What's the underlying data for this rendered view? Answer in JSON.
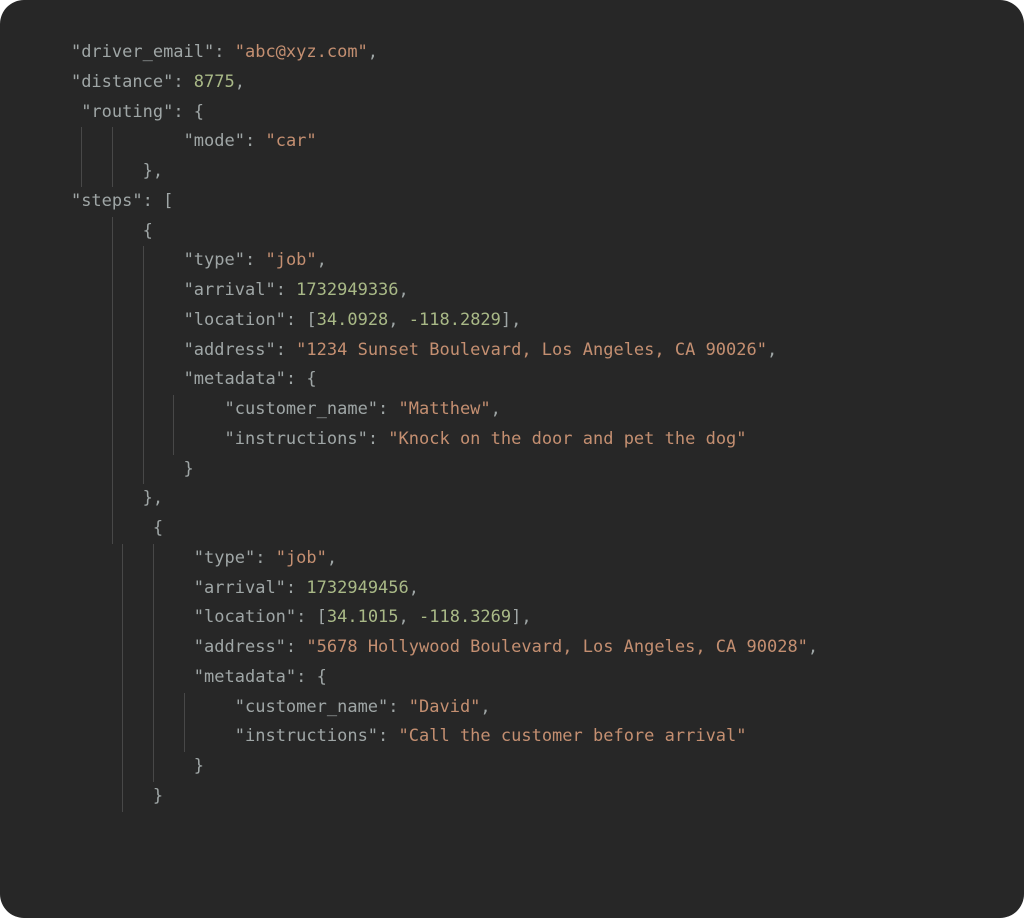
{
  "code": {
    "lines": [
      {
        "segments": [
          {
            "t": "    ",
            "c": "sp"
          },
          {
            "t": "\"driver_email\"",
            "c": "key"
          },
          {
            "t": ": ",
            "c": "punct"
          },
          {
            "t": "\"abc@xyz.com\"",
            "c": "string"
          },
          {
            "t": ",",
            "c": "punct"
          }
        ]
      },
      {
        "segments": [
          {
            "t": "    ",
            "c": "sp"
          },
          {
            "t": "\"distance\"",
            "c": "key"
          },
          {
            "t": ": ",
            "c": "punct"
          },
          {
            "t": "8775",
            "c": "number"
          },
          {
            "t": ",",
            "c": "punct"
          }
        ]
      },
      {
        "segments": [
          {
            "t": "     ",
            "c": "sp"
          },
          {
            "t": "\"routing\"",
            "c": "key"
          },
          {
            "t": ": {",
            "c": "punct"
          }
        ]
      },
      {
        "guides": 2,
        "guidePrefix": "     ",
        "segments": [
          {
            "t": "      ",
            "c": "sp"
          },
          {
            "t": "\"mode\"",
            "c": "key"
          },
          {
            "t": ": ",
            "c": "punct"
          },
          {
            "t": "\"car\"",
            "c": "string"
          }
        ]
      },
      {
        "guides": 2,
        "guidePrefix": "     ",
        "segments": [
          {
            "t": "  },",
            "c": "punct"
          }
        ]
      },
      {
        "segments": [
          {
            "t": "    ",
            "c": "sp"
          },
          {
            "t": "\"steps\"",
            "c": "key"
          },
          {
            "t": ": [",
            "c": "punct"
          }
        ]
      },
      {
        "guides": 1,
        "guidePrefix": "        ",
        "segments": [
          {
            "t": "  {",
            "c": "punct"
          }
        ]
      },
      {
        "guides": 2,
        "guidePrefix": "        ",
        "segments": [
          {
            "t": "   ",
            "c": "sp"
          },
          {
            "t": "\"type\"",
            "c": "key"
          },
          {
            "t": ": ",
            "c": "punct"
          },
          {
            "t": "\"job\"",
            "c": "string"
          },
          {
            "t": ",",
            "c": "punct"
          }
        ]
      },
      {
        "guides": 2,
        "guidePrefix": "        ",
        "segments": [
          {
            "t": "   ",
            "c": "sp"
          },
          {
            "t": "\"arrival\"",
            "c": "key"
          },
          {
            "t": ": ",
            "c": "punct"
          },
          {
            "t": "1732949336",
            "c": "number"
          },
          {
            "t": ",",
            "c": "punct"
          }
        ]
      },
      {
        "guides": 2,
        "guidePrefix": "        ",
        "segments": [
          {
            "t": "   ",
            "c": "sp"
          },
          {
            "t": "\"location\"",
            "c": "key"
          },
          {
            "t": ": [",
            "c": "punct"
          },
          {
            "t": "34.0928",
            "c": "number"
          },
          {
            "t": ", ",
            "c": "punct"
          },
          {
            "t": "-118.2829",
            "c": "number"
          },
          {
            "t": "],",
            "c": "punct"
          }
        ]
      },
      {
        "guides": 2,
        "guidePrefix": "        ",
        "segments": [
          {
            "t": "   ",
            "c": "sp"
          },
          {
            "t": "\"address\"",
            "c": "key"
          },
          {
            "t": ": ",
            "c": "punct"
          },
          {
            "t": "\"1234 Sunset Boulevard, Los Angeles, CA 90026\"",
            "c": "string"
          },
          {
            "t": ",",
            "c": "punct"
          }
        ]
      },
      {
        "guides": 2,
        "guidePrefix": "        ",
        "segments": [
          {
            "t": "   ",
            "c": "sp"
          },
          {
            "t": "\"metadata\"",
            "c": "key"
          },
          {
            "t": ": {",
            "c": "punct"
          }
        ]
      },
      {
        "guides": 3,
        "guidePrefix": "        ",
        "segments": [
          {
            "t": "    ",
            "c": "sp"
          },
          {
            "t": "\"customer_name\"",
            "c": "key"
          },
          {
            "t": ": ",
            "c": "punct"
          },
          {
            "t": "\"Matthew\"",
            "c": "string"
          },
          {
            "t": ",",
            "c": "punct"
          }
        ]
      },
      {
        "guides": 3,
        "guidePrefix": "        ",
        "segments": [
          {
            "t": "    ",
            "c": "sp"
          },
          {
            "t": "\"instructions\"",
            "c": "key"
          },
          {
            "t": ": ",
            "c": "punct"
          },
          {
            "t": "\"Knock on the door and pet the dog\"",
            "c": "string"
          }
        ]
      },
      {
        "guides": 2,
        "guidePrefix": "        ",
        "segments": [
          {
            "t": "   }",
            "c": "punct"
          }
        ]
      },
      {
        "guides": 1,
        "guidePrefix": "        ",
        "segments": [
          {
            "t": "  },",
            "c": "punct"
          }
        ]
      },
      {
        "guides": 1,
        "guidePrefix": "        ",
        "segments": [
          {
            "t": "   {",
            "c": "punct"
          }
        ]
      },
      {
        "guides": 2,
        "guidePrefix": "         ",
        "segments": [
          {
            "t": "   ",
            "c": "sp"
          },
          {
            "t": "\"type\"",
            "c": "key"
          },
          {
            "t": ": ",
            "c": "punct"
          },
          {
            "t": "\"job\"",
            "c": "string"
          },
          {
            "t": ",",
            "c": "punct"
          }
        ]
      },
      {
        "guides": 2,
        "guidePrefix": "         ",
        "segments": [
          {
            "t": "   ",
            "c": "sp"
          },
          {
            "t": "\"arrival\"",
            "c": "key"
          },
          {
            "t": ": ",
            "c": "punct"
          },
          {
            "t": "1732949456",
            "c": "number"
          },
          {
            "t": ",",
            "c": "punct"
          }
        ]
      },
      {
        "guides": 2,
        "guidePrefix": "         ",
        "segments": [
          {
            "t": "   ",
            "c": "sp"
          },
          {
            "t": "\"location\"",
            "c": "key"
          },
          {
            "t": ": [",
            "c": "punct"
          },
          {
            "t": "34.1015",
            "c": "number"
          },
          {
            "t": ", ",
            "c": "punct"
          },
          {
            "t": "-118.3269",
            "c": "number"
          },
          {
            "t": "],",
            "c": "punct"
          }
        ]
      },
      {
        "guides": 2,
        "guidePrefix": "         ",
        "segments": [
          {
            "t": "   ",
            "c": "sp"
          },
          {
            "t": "\"address\"",
            "c": "key"
          },
          {
            "t": ": ",
            "c": "punct"
          },
          {
            "t": "\"5678 Hollywood Boulevard, Los Angeles, CA 90028\"",
            "c": "string"
          },
          {
            "t": ",",
            "c": "punct"
          }
        ]
      },
      {
        "guides": 2,
        "guidePrefix": "         ",
        "segments": [
          {
            "t": "   ",
            "c": "sp"
          },
          {
            "t": "\"metadata\"",
            "c": "key"
          },
          {
            "t": ": {",
            "c": "punct"
          }
        ]
      },
      {
        "guides": 3,
        "guidePrefix": "         ",
        "segments": [
          {
            "t": "    ",
            "c": "sp"
          },
          {
            "t": "\"customer_name\"",
            "c": "key"
          },
          {
            "t": ": ",
            "c": "punct"
          },
          {
            "t": "\"David\"",
            "c": "string"
          },
          {
            "t": ",",
            "c": "punct"
          }
        ]
      },
      {
        "guides": 3,
        "guidePrefix": "         ",
        "segments": [
          {
            "t": "    ",
            "c": "sp"
          },
          {
            "t": "\"instructions\"",
            "c": "key"
          },
          {
            "t": ": ",
            "c": "punct"
          },
          {
            "t": "\"Call the customer before arrival\"",
            "c": "string"
          }
        ]
      },
      {
        "guides": 2,
        "guidePrefix": "         ",
        "segments": [
          {
            "t": "   }",
            "c": "punct"
          }
        ]
      },
      {
        "guides": 1,
        "guidePrefix": "         ",
        "segments": [
          {
            "t": "  }",
            "c": "punct"
          }
        ]
      }
    ]
  },
  "chart_data": {
    "type": "json_snippet",
    "driver_email": "abc@xyz.com",
    "distance": 8775,
    "routing": {
      "mode": "car"
    },
    "steps": [
      {
        "type": "job",
        "arrival": 1732949336,
        "location": [
          34.0928,
          -118.2829
        ],
        "address": "1234 Sunset Boulevard, Los Angeles, CA 90026",
        "metadata": {
          "customer_name": "Matthew",
          "instructions": "Knock on the door and pet the dog"
        }
      },
      {
        "type": "job",
        "arrival": 1732949456,
        "location": [
          34.1015,
          -118.3269
        ],
        "address": "5678 Hollywood Boulevard, Los Angeles, CA 90028",
        "metadata": {
          "customer_name": "David",
          "instructions": "Call the customer before arrival"
        }
      }
    ]
  }
}
